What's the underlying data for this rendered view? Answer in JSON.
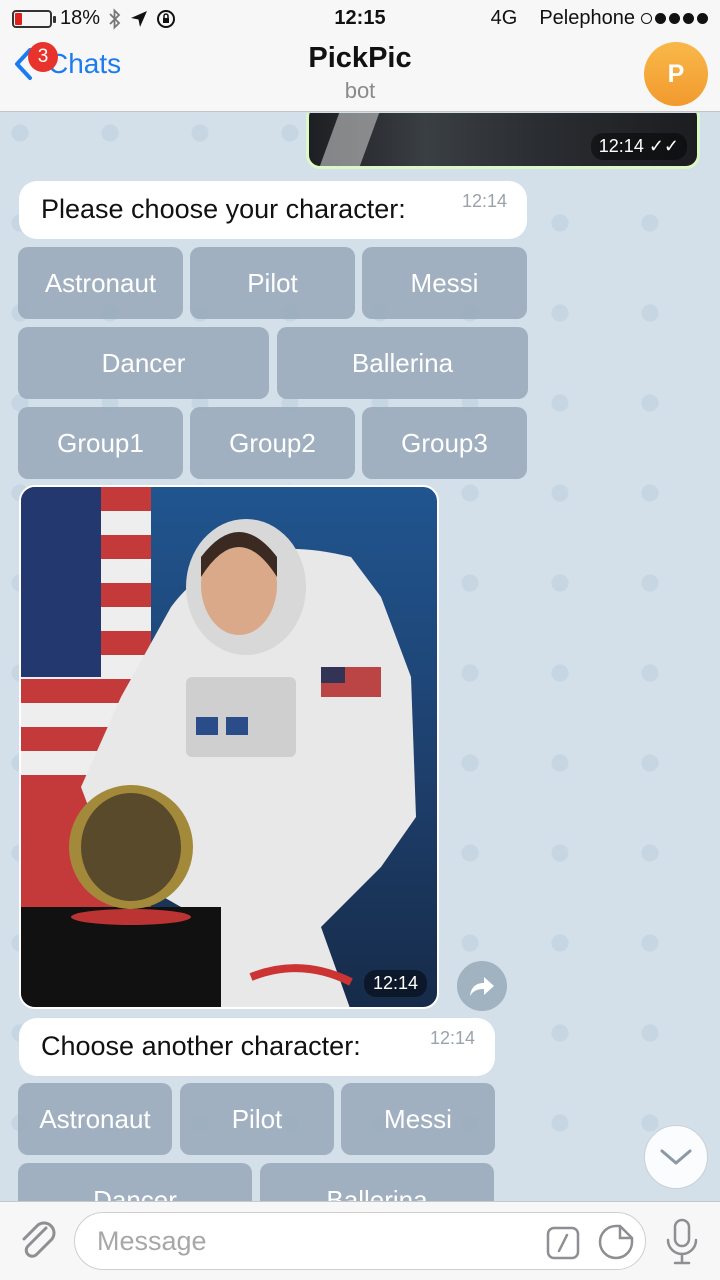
{
  "status_bar": {
    "battery_percent": "18%",
    "time": "12:15",
    "network": "4G",
    "carrier": "Pelephone"
  },
  "header": {
    "back_label": "Chats",
    "unread_badge": "3",
    "title": "PickPic",
    "subtitle": "bot",
    "avatar_letter": "P"
  },
  "messages": {
    "outgoing_photo_time": "12:14",
    "prompt1": {
      "text": "Please choose your character:",
      "time": "12:14"
    },
    "keyboard1": {
      "row1": [
        "Astronaut",
        "Pilot",
        "Messi"
      ],
      "row2": [
        "Dancer",
        "Ballerina"
      ],
      "row3": [
        "Group1",
        "Group2",
        "Group3"
      ]
    },
    "photo_time": "12:14",
    "prompt2": {
      "text": "Choose another character:",
      "time": "12:14"
    },
    "keyboard2": {
      "row1": [
        "Astronaut",
        "Pilot",
        "Messi"
      ],
      "row2": [
        "Dancer",
        "Ballerina"
      ]
    }
  },
  "input": {
    "placeholder": "Message"
  },
  "colors": {
    "accent": "#1b7cf2",
    "badge": "#e8332c",
    "chat_background": "#d3dfe9",
    "keyboard_button": "#96a8b8",
    "avatar": "#f4a53a"
  },
  "icons": [
    "back-chevron-icon",
    "attach-icon",
    "command-icon",
    "sticker-icon",
    "mic-icon",
    "share-icon",
    "chevron-down-icon",
    "bluetooth-icon",
    "location-icon",
    "lock-rotation-icon"
  ]
}
